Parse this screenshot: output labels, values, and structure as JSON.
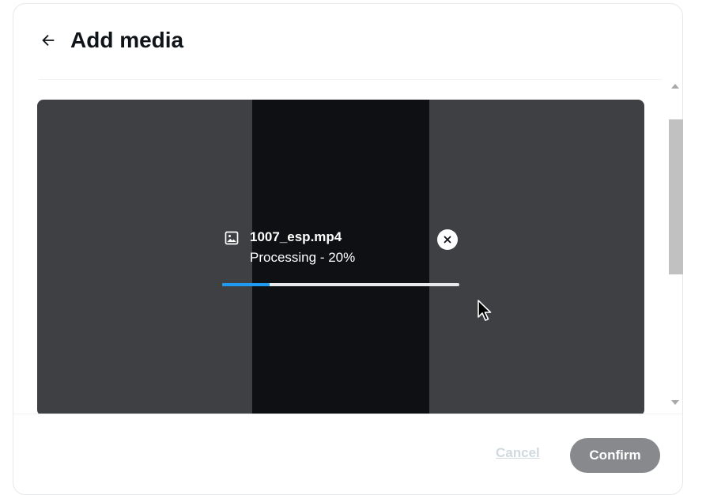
{
  "header": {
    "title": "Add media",
    "back_icon": "arrow-left-icon"
  },
  "upload": {
    "file_name": "1007_esp.mp4",
    "status": "Processing - 20%",
    "progress": 0.2,
    "file_icon": "image-icon",
    "remove_icon": "close-icon"
  },
  "footer": {
    "cancel_label": "Cancel",
    "confirm_label": "Confirm"
  },
  "colors": {
    "progress_fill": "#1d9bf0",
    "confirm_bg": "#87898c",
    "media_bg": "#3e4043",
    "media_center": "#0e1013"
  }
}
